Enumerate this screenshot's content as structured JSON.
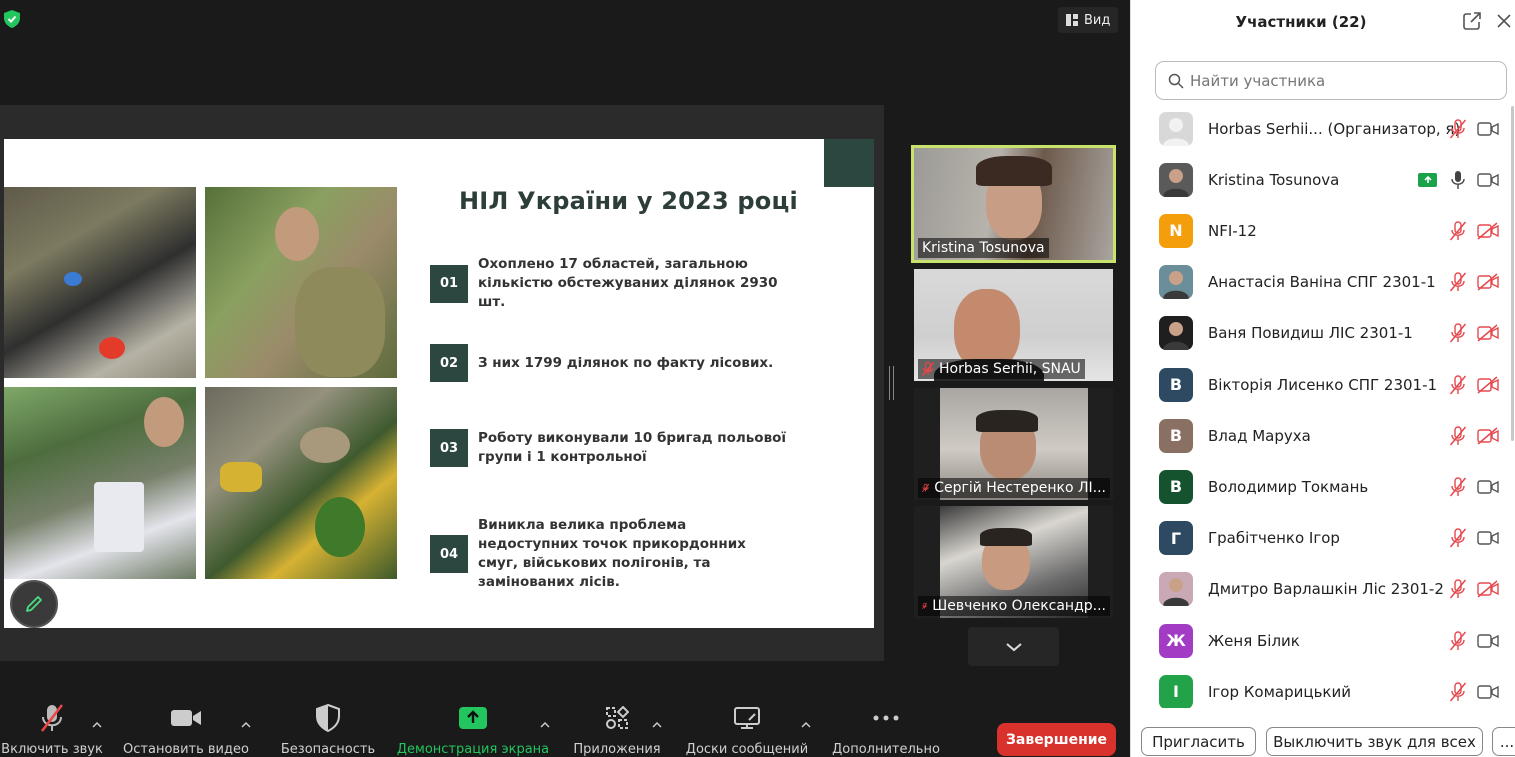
{
  "view_button": {
    "label": "Вид"
  },
  "slide": {
    "title": "НІЛ України у 2023 році",
    "items": [
      {
        "num": "01",
        "text": "Охоплено 17 областей, загальною кількістю обстежуваних ділянок 2930 шт."
      },
      {
        "num": "02",
        "text": "З них 1799 ділянок по факту лісових."
      },
      {
        "num": "03",
        "text": "Роботу виконували 10 бригад польової групи і 1 контрольної"
      },
      {
        "num": "04",
        "text": "Виникла велика проблема недоступних точок прикордонних смуг, військових полігонів, та замінованих лісів."
      }
    ]
  },
  "tiles": [
    {
      "name": "Kristina Tosunova",
      "muted": false,
      "active": true
    },
    {
      "name": "Horbas Serhii, SNAU",
      "muted": true,
      "active": false
    },
    {
      "name": "Сергій Нестеренко ЛІ...",
      "muted": true,
      "active": false
    },
    {
      "name": "Шевченко Олександр...",
      "muted": true,
      "active": false
    }
  ],
  "toolbar": {
    "mute": "Включить звук",
    "video": "Остановить видео",
    "security": "Безопасность",
    "share": "Демонстрация экрана",
    "apps": "Приложения",
    "whiteboards": "Доски сообщений",
    "more": "Дополнительно",
    "end": "Завершение"
  },
  "panel": {
    "title": "Участники (22)",
    "search_placeholder": "Найти участника",
    "participants": [
      {
        "name": "Horbas Serhii... (Организатор, я)",
        "avatar_type": "photo-blank",
        "avatar_letter": "",
        "color": "#d8d8d8",
        "mic": "muted",
        "cam": "on",
        "sharing": false
      },
      {
        "name": "Kristina Tosunova",
        "avatar_type": "photo",
        "avatar_letter": "",
        "color": "#5a5a5a",
        "mic": "on",
        "cam": "on",
        "sharing": true
      },
      {
        "name": "NFI-12",
        "avatar_type": "letter",
        "avatar_letter": "N",
        "color": "#f59e0b",
        "mic": "muted",
        "cam": "off",
        "sharing": false
      },
      {
        "name": "Анастасія Ваніна СПГ 2301-1",
        "avatar_type": "photo",
        "avatar_letter": "",
        "color": "#6b8f9a",
        "mic": "muted",
        "cam": "off",
        "sharing": false
      },
      {
        "name": "Ваня Повидиш ЛІС 2301-1",
        "avatar_type": "photo",
        "avatar_letter": "",
        "color": "#1f1f1f",
        "mic": "muted",
        "cam": "off",
        "sharing": false
      },
      {
        "name": "Вікторія Лисенко СПГ 2301-1",
        "avatar_type": "letter",
        "avatar_letter": "В",
        "color": "#2e4a62",
        "mic": "muted",
        "cam": "off",
        "sharing": false
      },
      {
        "name": "Влад Маруха",
        "avatar_type": "letter",
        "avatar_letter": "В",
        "color": "#8a6f63",
        "mic": "muted",
        "cam": "off",
        "sharing": false
      },
      {
        "name": "Володимир Токмань",
        "avatar_type": "letter",
        "avatar_letter": "В",
        "color": "#14532d",
        "mic": "muted",
        "cam": "on",
        "sharing": false
      },
      {
        "name": "Грабітченко Ігор",
        "avatar_type": "letter",
        "avatar_letter": "Г",
        "color": "#2e4a62",
        "mic": "muted",
        "cam": "on",
        "sharing": false
      },
      {
        "name": "Дмитро Варлашкін Ліс 2301-2",
        "avatar_type": "photo",
        "avatar_letter": "",
        "color": "#c9a9b5",
        "mic": "muted",
        "cam": "off",
        "sharing": false
      },
      {
        "name": "Женя Білик",
        "avatar_type": "letter",
        "avatar_letter": "Ж",
        "color": "#a33cc4",
        "mic": "muted",
        "cam": "on",
        "sharing": false
      },
      {
        "name": "Ігор Комарицький",
        "avatar_type": "letter",
        "avatar_letter": "І",
        "color": "#22a34a",
        "mic": "muted",
        "cam": "on",
        "sharing": false
      }
    ],
    "footer": {
      "invite": "Пригласить",
      "mute_all": "Выключить звук для всех",
      "more": "..."
    }
  }
}
